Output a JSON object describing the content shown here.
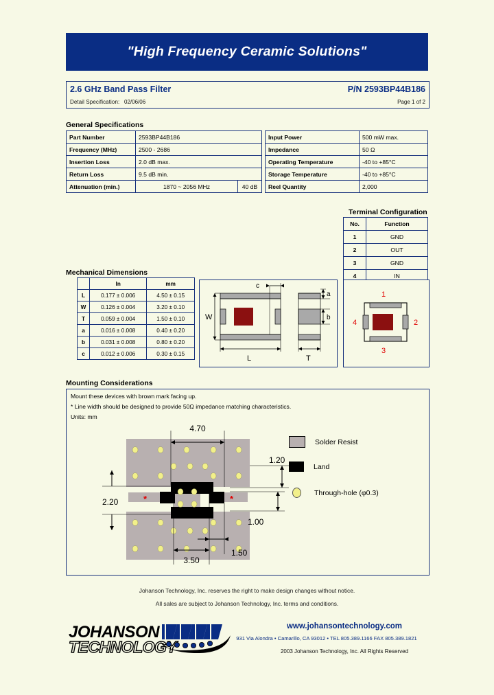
{
  "banner": {
    "tagline": "\"High Frequency Ceramic Solutions\""
  },
  "title_block": {
    "product_title": "2.6 GHz Band Pass Filter",
    "part_number": "P/N 2593BP44B186",
    "detail_spec_label": "Detail Specification:",
    "detail_spec_date": "02/06/06",
    "page_info": "Page 1 of 2"
  },
  "general_specifications": {
    "heading": "General Specifications",
    "left_rows": [
      {
        "key": "Part Number",
        "value": "2593BP44B186"
      },
      {
        "key": "Frequency (MHz)",
        "value": "2500 - 2686"
      },
      {
        "key": "Insertion Loss",
        "value": "2.0 dB max."
      },
      {
        "key": "Return Loss",
        "value": "9.5 dB min."
      }
    ],
    "attenuation": {
      "key": "Attenuation (min.)",
      "range": "1870 ~ 2056 MHz",
      "value": "40 dB"
    },
    "right_rows": [
      {
        "key": "Input Power",
        "value": "500 mW max."
      },
      {
        "key": "Impedance",
        "value": "50 Ω"
      },
      {
        "key": "Operating Temperature",
        "value": "-40 to +85°C"
      },
      {
        "key": "Storage Temperature",
        "value": "-40 to +85°C"
      },
      {
        "key": "Reel Quantity",
        "value": "2,000"
      }
    ]
  },
  "terminal_configuration": {
    "heading": "Terminal Configuration",
    "columns": [
      "No.",
      "Function"
    ],
    "rows": [
      {
        "no": "1",
        "function": "GND"
      },
      {
        "no": "2",
        "function": "OUT"
      },
      {
        "no": "3",
        "function": "GND"
      },
      {
        "no": "4",
        "function": "IN"
      }
    ],
    "diagram_labels": [
      "1",
      "2",
      "3",
      "4"
    ]
  },
  "mechanical_dimensions": {
    "heading": "Mechanical Dimensions",
    "columns": [
      "",
      "In",
      "mm"
    ],
    "rows": [
      {
        "symbol": "L",
        "in": "0.177  ±  0.006",
        "mm": "4.50  ±  0.15"
      },
      {
        "symbol": "W",
        "in": "0.126  ±  0.004",
        "mm": "3.20  ±  0.10"
      },
      {
        "symbol": "T",
        "in": "0.059  ±  0.004",
        "mm": "1.50  ±  0.10"
      },
      {
        "symbol": "a",
        "in": "0.016  ±  0.008",
        "mm": "0.40  ±  0.20"
      },
      {
        "symbol": "b",
        "in": "0.031  ±  0.008",
        "mm": "0.80  ±  0.20"
      },
      {
        "symbol": "c",
        "in": "0.012  ±  0.006",
        "mm": "0.30  ±  0.15"
      }
    ],
    "drawing_labels": {
      "width": "W",
      "length": "L",
      "thickness": "T",
      "c": "c",
      "a": "a",
      "b": "b"
    }
  },
  "mounting": {
    "heading": "Mounting Considerations",
    "note1": "Mount these devices with brown mark facing up.",
    "note2": "* Line width should be designed to provide 50Ω impedance matching characteristics.",
    "note3": "Units: mm",
    "dimensions": {
      "top": "4.70",
      "right_upper": "1.20",
      "right_lower": "1.00",
      "left": "2.20",
      "bottom_left": "3.50",
      "bottom_right": "1.50"
    },
    "asterisk": "*",
    "legend": [
      {
        "swatch": "solder-resist",
        "label": "Solder Resist"
      },
      {
        "swatch": "land",
        "label": "Land"
      },
      {
        "swatch": "through-hole",
        "label": "Through-hole (φ0.3)"
      }
    ]
  },
  "footer": {
    "note1": "Johanson Technology, Inc. reserves the right to make design changes without notice.",
    "note2": "All sales are subject to Johanson Technology, Inc. terms and conditions.",
    "logo_line1": "JOHANSON",
    "logo_line2": "TECHNOLOGY",
    "website": "www.johansontechnology.com",
    "address": "931 Via Alondra • Camarillo, CA 93012 • TEL 805.389.1166 FAX 805.389.1821",
    "copyright": "2003 Johanson Technology, Inc.  All Rights Reserved"
  },
  "colors": {
    "page_background": "#f7f9e6",
    "brand_blue": "#0a2d84",
    "border_blue": "#16307c",
    "solder_resist": "#b8b0b0",
    "land": "#000000",
    "through_hole": "#f2f08a",
    "brown_mark": "#8b1010",
    "terminal_gray": "#a9a9a9",
    "red_mark": "#e00000"
  }
}
